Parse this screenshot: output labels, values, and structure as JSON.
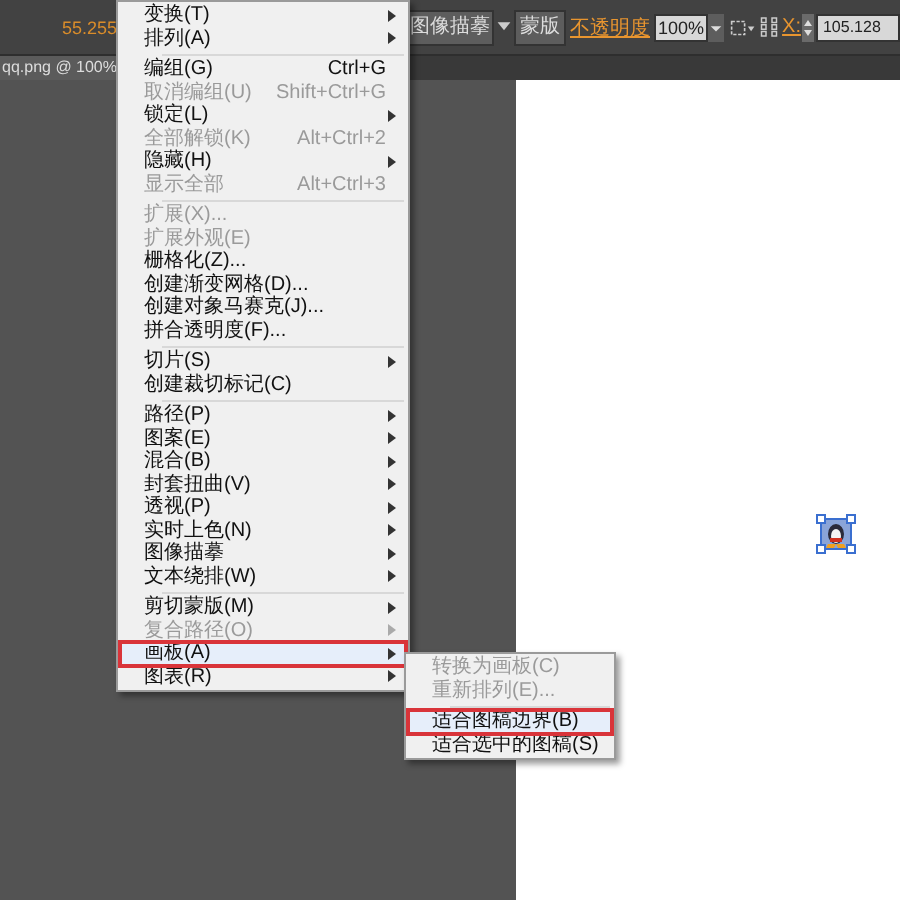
{
  "toolbar": {
    "left_value": "55.255",
    "trace_button": "图像描摹",
    "mask_button": "蒙版",
    "opacity_label": "不透明度",
    "opacity_value": "100%",
    "x_label": "X:",
    "x_value": "105.128"
  },
  "document_tab": {
    "title": "qq.png @ 100%"
  },
  "menu": {
    "groups": [
      [
        {
          "label": "变换(T)",
          "has_submenu": true,
          "disabled": false,
          "selected": false
        },
        {
          "label": "排列(A)",
          "has_submenu": true,
          "disabled": false,
          "selected": false
        }
      ],
      [
        {
          "label": "编组(G)",
          "shortcut": "Ctrl+G",
          "has_submenu": false,
          "disabled": false,
          "selected": false
        },
        {
          "label": "取消编组(U)",
          "shortcut": "Shift+Ctrl+G",
          "has_submenu": false,
          "disabled": true,
          "selected": false
        },
        {
          "label": "锁定(L)",
          "has_submenu": true,
          "disabled": false,
          "selected": false
        },
        {
          "label": "全部解锁(K)",
          "shortcut": "Alt+Ctrl+2",
          "has_submenu": false,
          "disabled": true,
          "selected": false
        },
        {
          "label": "隐藏(H)",
          "has_submenu": true,
          "disabled": false,
          "selected": false
        },
        {
          "label": "显示全部",
          "shortcut": "Alt+Ctrl+3",
          "has_submenu": false,
          "disabled": true,
          "selected": false
        }
      ],
      [
        {
          "label": "扩展(X)...",
          "has_submenu": false,
          "disabled": true,
          "selected": false
        },
        {
          "label": "扩展外观(E)",
          "has_submenu": false,
          "disabled": true,
          "selected": false
        },
        {
          "label": "栅格化(Z)...",
          "has_submenu": false,
          "disabled": false,
          "selected": false
        },
        {
          "label": "创建渐变网格(D)...",
          "has_submenu": false,
          "disabled": false,
          "selected": false
        },
        {
          "label": "创建对象马赛克(J)...",
          "has_submenu": false,
          "disabled": false,
          "selected": false
        },
        {
          "label": "拼合透明度(F)...",
          "has_submenu": false,
          "disabled": false,
          "selected": false
        }
      ],
      [
        {
          "label": "切片(S)",
          "has_submenu": true,
          "disabled": false,
          "selected": false
        },
        {
          "label": "创建裁切标记(C)",
          "has_submenu": false,
          "disabled": false,
          "selected": false
        }
      ],
      [
        {
          "label": "路径(P)",
          "has_submenu": true,
          "disabled": false,
          "selected": false
        },
        {
          "label": "图案(E)",
          "has_submenu": true,
          "disabled": false,
          "selected": false
        },
        {
          "label": "混合(B)",
          "has_submenu": true,
          "disabled": false,
          "selected": false
        },
        {
          "label": "封套扭曲(V)",
          "has_submenu": true,
          "disabled": false,
          "selected": false
        },
        {
          "label": "透视(P)",
          "has_submenu": true,
          "disabled": false,
          "selected": false
        },
        {
          "label": "实时上色(N)",
          "has_submenu": true,
          "disabled": false,
          "selected": false
        },
        {
          "label": "图像描摹",
          "has_submenu": true,
          "disabled": false,
          "selected": false
        },
        {
          "label": "文本绕排(W)",
          "has_submenu": true,
          "disabled": false,
          "selected": false
        }
      ],
      [
        {
          "label": "剪切蒙版(M)",
          "has_submenu": true,
          "disabled": false,
          "selected": false
        },
        {
          "label": "复合路径(O)",
          "has_submenu": true,
          "disabled": true,
          "selected": false
        },
        {
          "label": "画板(A)",
          "has_submenu": true,
          "disabled": false,
          "selected": true
        },
        {
          "label": "图表(R)",
          "has_submenu": true,
          "disabled": false,
          "selected": false
        }
      ]
    ]
  },
  "submenu": {
    "groups": [
      [
        {
          "label": "转换为画板(C)",
          "has_submenu": false,
          "disabled": true,
          "selected": false
        },
        {
          "label": "重新排列(E)...",
          "has_submenu": false,
          "disabled": true,
          "selected": false
        }
      ],
      [
        {
          "label": "适合图稿边界(B)",
          "has_submenu": false,
          "disabled": false,
          "selected": true
        },
        {
          "label": "适合选中的图稿(S)",
          "has_submenu": false,
          "disabled": false,
          "selected": false
        }
      ]
    ]
  }
}
